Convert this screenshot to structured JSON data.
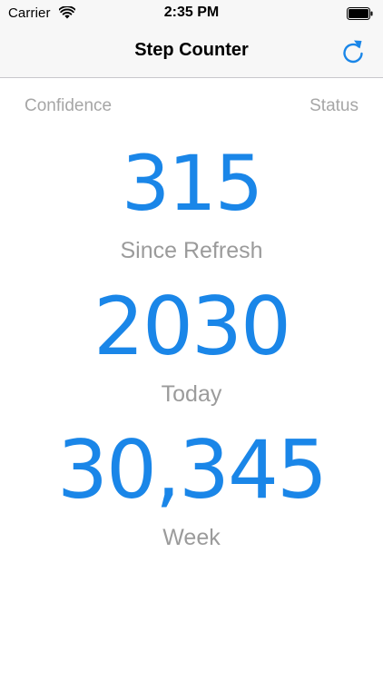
{
  "status_bar": {
    "carrier": "Carrier",
    "time": "2:35 PM",
    "wifi_icon": "wifi-icon",
    "battery_icon": "battery-icon"
  },
  "nav": {
    "title": "Step Counter",
    "refresh_icon": "refresh-icon"
  },
  "labels": {
    "confidence": "Confidence",
    "status": "Status"
  },
  "counters": [
    {
      "value": "315",
      "caption": "Since Refresh"
    },
    {
      "value": "2030",
      "caption": "Today"
    },
    {
      "value": "30,345",
      "caption": "Week"
    }
  ],
  "colors": {
    "accent": "#1a86e8",
    "caption": "#9b9b9b",
    "label": "#a6a6a6",
    "bar_background": "#f7f7f7"
  }
}
